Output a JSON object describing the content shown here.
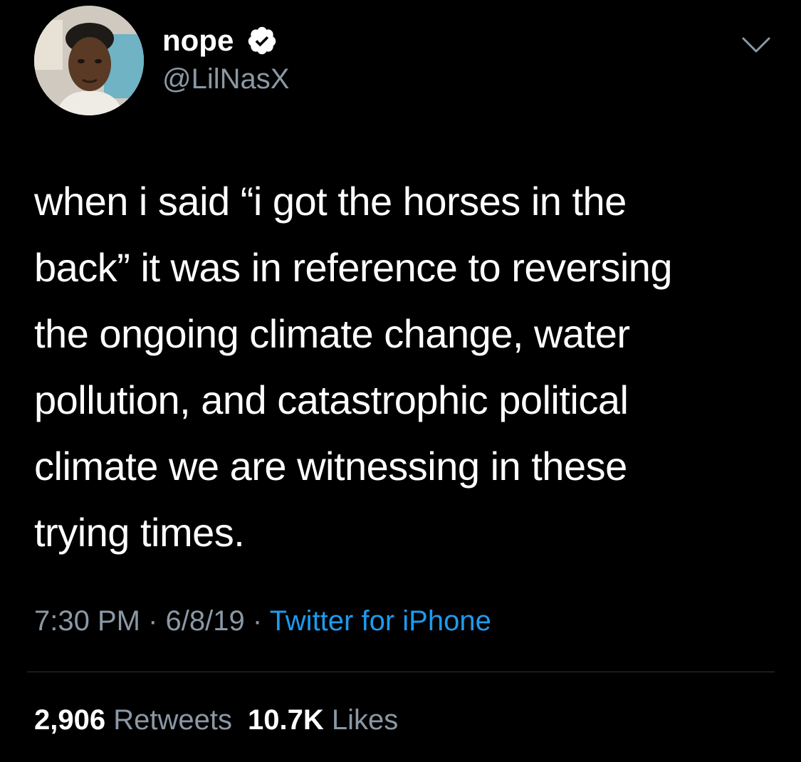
{
  "user": {
    "display_name": "nope",
    "handle": "@LilNasX",
    "verified": true,
    "avatar_icon": "profile-photo"
  },
  "tweet": {
    "text": "when i said “i got the horses in the\nback” it was in reference to reversing\nthe ongoing climate change, water\npollution, and catastrophic political\nclimate we are witnessing in these\ntrying times."
  },
  "meta": {
    "time": "7:30 PM",
    "separator": " · ",
    "date": "6/8/19",
    "source": "Twitter for iPhone"
  },
  "stats": {
    "retweets_count": "2,906",
    "retweets_label": "Retweets",
    "likes_count": "10.7K",
    "likes_label": "Likes"
  },
  "colors": {
    "background": "#000000",
    "text": "#ffffff",
    "muted": "#8b98a5",
    "accent": "#1d9bf0",
    "divider": "#2f3336"
  }
}
